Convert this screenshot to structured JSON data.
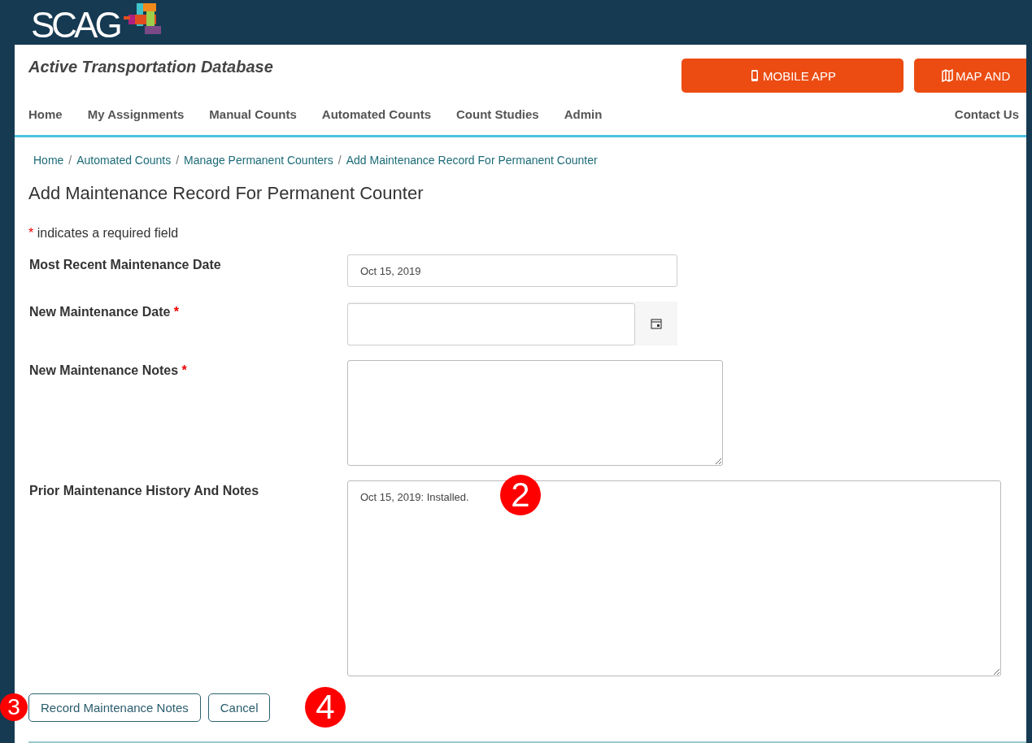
{
  "logo": {
    "text": "SCAG"
  },
  "app_title": "Active Transportation Database",
  "header_buttons": [
    {
      "label": "MOBILE APP"
    },
    {
      "label": "MAP AND"
    }
  ],
  "nav": {
    "items": [
      "Home",
      "My Assignments",
      "Manual Counts",
      "Automated Counts",
      "Count Studies",
      "Admin"
    ],
    "right": "Contact Us"
  },
  "breadcrumb_separator": "/",
  "breadcrumb": [
    "Home",
    "Automated Counts",
    "Manage Permanent Counters",
    "Add Maintenance Record For Permanent Counter"
  ],
  "heading": "Add Maintenance Record For Permanent Counter",
  "required_mark": "*",
  "required_note": "indicates a required field",
  "fields": [
    {
      "label": "Most Recent Maintenance Date",
      "required": false,
      "kind": "text",
      "value": "Oct 15, 2019"
    },
    {
      "label": "New Maintenance Date",
      "required": true,
      "kind": "date"
    },
    {
      "label": "New Maintenance Notes",
      "required": true,
      "kind": "textarea"
    },
    {
      "label": "Prior Maintenance History And Notes",
      "required": false,
      "kind": "history",
      "value": "Oct 15, 2019: Installed."
    }
  ],
  "buttons": [
    "Record Maintenance Notes",
    "Cancel"
  ],
  "callouts": [
    {
      "text": "2"
    },
    {
      "text": "3"
    },
    {
      "text": "4"
    }
  ]
}
